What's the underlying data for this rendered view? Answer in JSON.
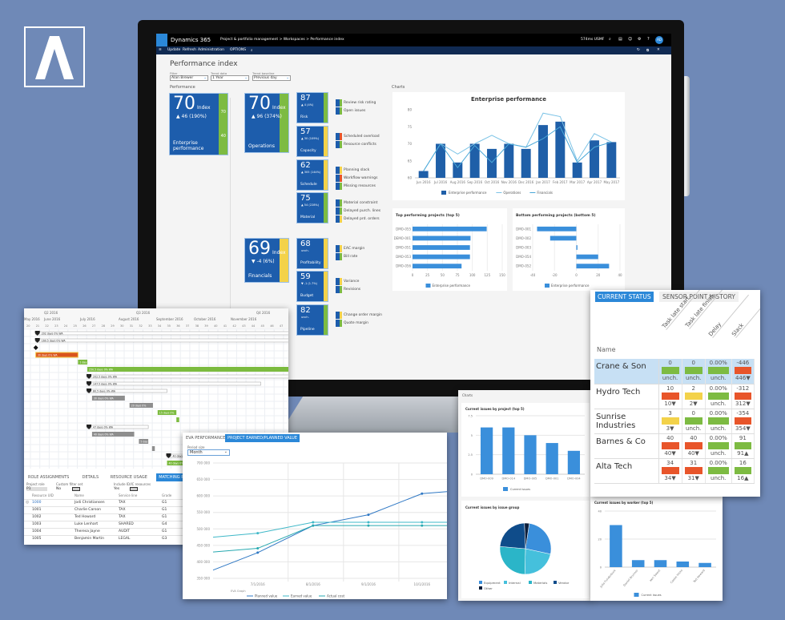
{
  "colors": {
    "background": "#6f89b7",
    "tile_blue": "#1d5dac",
    "green": "#7dbb42",
    "yellow": "#f3d24a",
    "red": "#e8552a",
    "accent": "#2b88d8"
  },
  "header": {
    "app": "Dynamics 365",
    "breadcrumb": "Project & portfolio management  >  Workspaces  >  Performance index",
    "company": "574ms  USMF",
    "icons": [
      "search-icon",
      "chat-icon",
      "smile-icon",
      "gear-icon",
      "help-icon"
    ],
    "avatar": "AD"
  },
  "toolbar": {
    "items": [
      "Update",
      "Refresh",
      "Administration",
      "OPTIONS"
    ]
  },
  "page": {
    "title": "Performance index",
    "filters": [
      {
        "label": "Filter",
        "value": "Alan Brewer"
      },
      {
        "label": "Trend data",
        "value": "1 Year"
      },
      {
        "label": "Trend baseline",
        "value": "Previous day"
      }
    ],
    "section": "Performance",
    "charts_label": "Charts"
  },
  "tiles": {
    "enterprise": {
      "value": "70",
      "index": "Index",
      "change": "▲ 46 (190%)",
      "name": "Enterprise performance",
      "strip": "green",
      "scale": [
        "70",
        "40"
      ]
    },
    "operations": {
      "value": "70",
      "index": "Index",
      "change": "▲ 96 (374%)",
      "name": "Operations",
      "strip": "green"
    },
    "financials": {
      "value": "69",
      "index": "Index",
      "change": "▼ -4 (6%)",
      "name": "Financials",
      "strip": "yellow"
    },
    "sub": [
      {
        "value": "87",
        "change": "▲ 4 (4%)",
        "name": "Risk",
        "strip": "green",
        "checks": [
          {
            "label": "Review risk rating",
            "color": "green"
          },
          {
            "label": "Open issues",
            "color": "green"
          }
        ]
      },
      {
        "value": "57",
        "change": "▲ 30 (109%)",
        "name": "Capacity",
        "strip": "yellow",
        "checks": [
          {
            "label": "Scheduled overload",
            "color": "red"
          },
          {
            "label": "Resource conflicts",
            "color": "green"
          }
        ]
      },
      {
        "value": "62",
        "change": "▲ 305 (144%)",
        "name": "Schedule",
        "strip": "yellow",
        "checks": [
          {
            "label": "Planning slack",
            "color": "yellow"
          },
          {
            "label": "Workflow warnings",
            "color": "red"
          },
          {
            "label": "Missing resources",
            "color": "green"
          }
        ]
      },
      {
        "value": "75",
        "change": "▲ 54 (228%)",
        "name": "Material",
        "strip": "green",
        "checks": [
          {
            "label": "Material constraint",
            "color": "green"
          },
          {
            "label": "Delayed purch. lines",
            "color": "green"
          },
          {
            "label": "Delayed prd. orders",
            "color": "yellow"
          }
        ]
      },
      {
        "value": "68",
        "change": "unch.",
        "name": "Profitability",
        "strip": "yellow",
        "checks": [
          {
            "label": "EAC margin",
            "color": "yellow"
          },
          {
            "label": "Bill rate",
            "color": "green"
          }
        ]
      },
      {
        "value": "59",
        "change": "▼ -1 (1.7%)",
        "name": "Budget",
        "strip": "yellow",
        "checks": [
          {
            "label": "Variance",
            "color": "yellow"
          },
          {
            "label": "Revisions",
            "color": "green"
          }
        ]
      },
      {
        "value": "82",
        "change": "unch.",
        "name": "Pipeline",
        "strip": "green",
        "checks": [
          {
            "label": "Change order margin",
            "color": "yellow"
          },
          {
            "label": "Quote margin",
            "color": "green"
          }
        ]
      }
    ]
  },
  "chart_data": [
    {
      "id": "enterprise",
      "type": "bar",
      "title": "Enterprise performance",
      "categories": [
        "Jun 2016",
        "Jul 2016",
        "Aug 2016",
        "Sep 2016",
        "Oct 2016",
        "Nov 2016",
        "Dec 2016",
        "Jan 2017",
        "Feb 2017",
        "Mar 2017",
        "Apr 2017",
        "May 2017"
      ],
      "ylim": [
        60,
        80
      ],
      "yticks": [
        60,
        65,
        70,
        75,
        80
      ],
      "grid": false,
      "legend": "bottom",
      "series": [
        {
          "name": "Enterprise performance",
          "kind": "bar",
          "color": "#1f5fa8",
          "values": [
            62,
            70,
            64.5,
            70,
            68.5,
            70,
            68.5,
            75.5,
            76.5,
            64.5,
            71,
            70.5
          ]
        },
        {
          "name": "Operations",
          "kind": "line",
          "color": "#7cc3e6",
          "values": [
            62,
            70,
            67,
            70,
            72.5,
            70,
            69,
            79,
            78,
            65,
            73,
            70.5
          ]
        },
        {
          "name": "Financials",
          "kind": "line",
          "color": "#4aa8d8",
          "values": [
            62,
            70,
            63,
            69.5,
            64.5,
            70,
            69,
            71.5,
            75,
            64.5,
            69,
            70.5
          ]
        }
      ]
    },
    {
      "id": "top",
      "type": "hbar",
      "title": "Top performing projects (top 5)",
      "categories": [
        "DMO-055",
        "DEMO-001",
        "DMO-051",
        "DMO-053",
        "DMO-056"
      ],
      "values": [
        124,
        97,
        96,
        96,
        82
      ],
      "xlim": [
        0,
        150
      ],
      "xticks": [
        0,
        25,
        50,
        75,
        100,
        125,
        150
      ],
      "series_name": "Enterprise performance",
      "color": "#3a8fdb",
      "legend": "bottom"
    },
    {
      "id": "bottom",
      "type": "hbar",
      "title": "Bottom performing projects (bottom 5)",
      "categories": [
        "DMO-001",
        "DMO-002",
        "DMO-003",
        "DMO-054",
        "DMO-052"
      ],
      "values": [
        -36,
        -24,
        1,
        20,
        30
      ],
      "xlim": [
        -40,
        40
      ],
      "xticks": [
        -40,
        -20,
        0,
        20,
        40
      ],
      "series_name": "Enterprise performance",
      "color": "#3a8fdb",
      "legend": "bottom"
    },
    {
      "id": "issues-project",
      "type": "bar",
      "title": "Current issues by project (top 5)",
      "categories": [
        "DMO-009",
        "DMO-014",
        "DMO-005",
        "DMO-001",
        "DMO-004"
      ],
      "ylim": [
        0,
        7.5
      ],
      "yticks": [
        0,
        2.5,
        5,
        7.5
      ],
      "grid": true,
      "legend": "bottom",
      "series": [
        {
          "name": "Current issues",
          "kind": "bar",
          "color": "#3a8fdb",
          "values": [
            6,
            6,
            5,
            4,
            3
          ]
        }
      ]
    },
    {
      "id": "issues-group",
      "type": "pie",
      "title": "Current issues by issue group",
      "legend": "bottom",
      "slices": [
        {
          "label": "Equipment",
          "value": 26,
          "color": "#3a8fdb"
        },
        {
          "label": "Internal",
          "value": 22,
          "color": "#45c0dc"
        },
        {
          "label": "Materials",
          "value": 26,
          "color": "#2bb5c8"
        },
        {
          "label": "Vendor",
          "value": 23,
          "color": "#0f4c8a"
        },
        {
          "label": "Other",
          "value": 3,
          "color": "#0b1d3a"
        }
      ]
    },
    {
      "id": "issues-worker",
      "type": "bar",
      "title": "Current issues by worker (top 5)",
      "categories": [
        "Julia Funderburk",
        "Daniel Brunner",
        "Ken Sweet",
        "Cassie Hicks",
        "Ted Howard"
      ],
      "ylim": [
        0,
        40
      ],
      "yticks": [
        0,
        20,
        40
      ],
      "grid": true,
      "rotate_labels": true,
      "legend": "bottom",
      "series": [
        {
          "name": "Current issues",
          "kind": "bar",
          "color": "#3a8fdb",
          "values": [
            30,
            5,
            5,
            4,
            3
          ]
        }
      ]
    },
    {
      "id": "eva",
      "type": "line",
      "xlabel": "EVA Graph",
      "x": [
        "2016-06-06",
        "2016-07-01",
        "2016-08-01",
        "2016-09-01",
        "2016-10-01",
        "2016-10-15"
      ],
      "xticks": [
        "7/1/2016",
        "8/1/2016",
        "9/1/2016",
        "10/1/2016"
      ],
      "ylim": [
        350000,
        700000
      ],
      "yticks": [
        "350 000",
        "400 000",
        "450 000",
        "500 000",
        "550 000",
        "600 000",
        "650 000",
        "700 000"
      ],
      "grid": true,
      "legend": "bottom",
      "series": [
        {
          "name": "Planned value",
          "color": "#2f78c4",
          "values": [
            375000,
            428000,
            510000,
            543000,
            607000,
            613000
          ]
        },
        {
          "name": "Earned value",
          "color": "#3fb8c8",
          "values": [
            475000,
            487000,
            520000,
            520000,
            520000,
            520000
          ]
        },
        {
          "name": "Actual cost",
          "color": "#27a9b0",
          "values": [
            430000,
            441000,
            510000,
            510000,
            510000,
            510000
          ]
        }
      ]
    }
  ],
  "charts_panel_label": "Charts",
  "eva": {
    "tabs": [
      "EVA PERFORMANCE",
      "PROJECT EARNED/PLANNED VALUE"
    ],
    "period_label": "Period size",
    "period_value": "Month"
  },
  "status": {
    "tabs": [
      "CURRENT STATUS",
      "SENSOR POINT HISTORY"
    ],
    "name_header": "Name",
    "columns": [
      "Task late start",
      "Task late finish",
      "Delay",
      "Slack"
    ],
    "rows": [
      {
        "name": "Crane & Son",
        "selected": true,
        "cells": [
          {
            "v": "0",
            "c": "green",
            "d": "unch."
          },
          {
            "v": "0",
            "c": "green",
            "d": "unch."
          },
          {
            "v": "0.00%",
            "c": "green",
            "d": "unch."
          },
          {
            "v": "-446",
            "c": "red",
            "d": "446▼"
          }
        ]
      },
      {
        "name": "Hydro Tech",
        "cells": [
          {
            "v": "10",
            "c": "red",
            "d": "10▼"
          },
          {
            "v": "2",
            "c": "yellow",
            "d": "2▼"
          },
          {
            "v": "0.00%",
            "c": "green",
            "d": "unch."
          },
          {
            "v": "-312",
            "c": "red",
            "d": "312▼"
          }
        ]
      },
      {
        "name": "Sunrise Industries",
        "cells": [
          {
            "v": "3",
            "c": "yellow",
            "d": "3▼"
          },
          {
            "v": "0",
            "c": "green",
            "d": "unch."
          },
          {
            "v": "0.00%",
            "c": "green",
            "d": "unch."
          },
          {
            "v": "-354",
            "c": "red",
            "d": "354▼"
          }
        ]
      },
      {
        "name": "Barnes & Co",
        "cells": [
          {
            "v": "40",
            "c": "red",
            "d": "40▼"
          },
          {
            "v": "40",
            "c": "red",
            "d": "40▼"
          },
          {
            "v": "0.00%",
            "c": "green",
            "d": "unch."
          },
          {
            "v": "91",
            "c": "green",
            "d": "91▲"
          }
        ]
      },
      {
        "name": "Alta Tech",
        "cells": [
          {
            "v": "34",
            "c": "red",
            "d": "34▼"
          },
          {
            "v": "31",
            "c": "red",
            "d": "31▼"
          },
          {
            "v": "0.00%",
            "c": "green",
            "d": "unch."
          },
          {
            "v": "16",
            "c": "green",
            "d": "16▲"
          }
        ]
      }
    ]
  },
  "gantt": {
    "quarters": [
      "Q2 2016",
      "Q3 2016",
      "Q4 2016"
    ],
    "months": [
      "May 2016",
      "June 2016",
      "July 2016",
      "August 2016",
      "September 2016",
      "October 2016",
      "November 2016"
    ],
    "week_first": 20,
    "week_last": 47,
    "bars": [
      {
        "label": "202 days 0% WA",
        "kind": "summary",
        "start": 21,
        "end": 48
      },
      {
        "label": "160.5 days 0% WA",
        "kind": "summary",
        "start": 21,
        "end": 48
      },
      {
        "label": "",
        "kind": "milestone",
        "start": 21,
        "end": 21
      },
      {
        "label": "30 days 0% WA",
        "kind": "critical",
        "start": 21,
        "end": 25.5
      },
      {
        "label": "1 day",
        "kind": "task",
        "start": 25.5,
        "end": 26.5
      },
      {
        "label": "250.5 days 0% WA",
        "kind": "task",
        "start": 26.5,
        "end": 48
      },
      {
        "label": "202.5 days 0% WA",
        "kind": "summary",
        "start": 26.5,
        "end": 48
      },
      {
        "label": "147.5 days 0% WA",
        "kind": "summary",
        "start": 26.5,
        "end": 45
      },
      {
        "label": "80.5 days 0% WA",
        "kind": "summary",
        "start": 26.5,
        "end": 35
      },
      {
        "label": "30 days 0% WA",
        "kind": "grey",
        "start": 27,
        "end": 30.5
      },
      {
        "label": "20 days 0%",
        "kind": "grey",
        "start": 31,
        "end": 33.5
      },
      {
        "label": "15 days 0%",
        "kind": "task",
        "start": 34,
        "end": 36
      },
      {
        "label": "",
        "kind": "task",
        "start": 36,
        "end": 36.3
      },
      {
        "label": "47 days 0% WA",
        "kind": "summary",
        "start": 26.5,
        "end": 33
      },
      {
        "label": "40 days 0% WA",
        "kind": "grey",
        "start": 27,
        "end": 31.5
      },
      {
        "label": "5 day",
        "kind": "grey",
        "start": 32,
        "end": 33
      },
      {
        "label": "",
        "kind": "grey",
        "start": 33.4,
        "end": 33.7
      },
      {
        "label": "40 days 0% WA",
        "kind": "summary",
        "start": 35,
        "end": 38
      },
      {
        "label": "40 days 0% WA",
        "kind": "task",
        "start": 35,
        "end": 38
      }
    ]
  },
  "resources": {
    "tabs": [
      "ROLE ASSIGNMENTS",
      "DETAILS",
      "RESOURCE USAGE",
      "MATCHING RESOURCES",
      "ATTRIB"
    ],
    "active_tab": 3,
    "fields": [
      {
        "label": "Project role",
        "value": "P1"
      },
      {
        "label": "Custom filter set",
        "value": "No"
      },
      {
        "label": "Include ID/IC resources",
        "value": "Yes"
      }
    ],
    "columns": [
      "Resource UID",
      "Name",
      "Service line",
      "Grade"
    ],
    "rows": [
      [
        "1000",
        "Jodi Christiansen",
        "TAX",
        "G1"
      ],
      [
        "1001",
        "Charlie Carson",
        "TAX",
        "G1"
      ],
      [
        "1002",
        "Ted Howard",
        "TAX",
        "G1"
      ],
      [
        "1003",
        "Luke Lenhart",
        "SHARED",
        "G4"
      ],
      [
        "1004",
        "Theresa Jayne",
        "AUDIT",
        "G1"
      ],
      [
        "1005",
        "Benjamin Martin",
        "LEGAL",
        "G3"
      ]
    ]
  }
}
